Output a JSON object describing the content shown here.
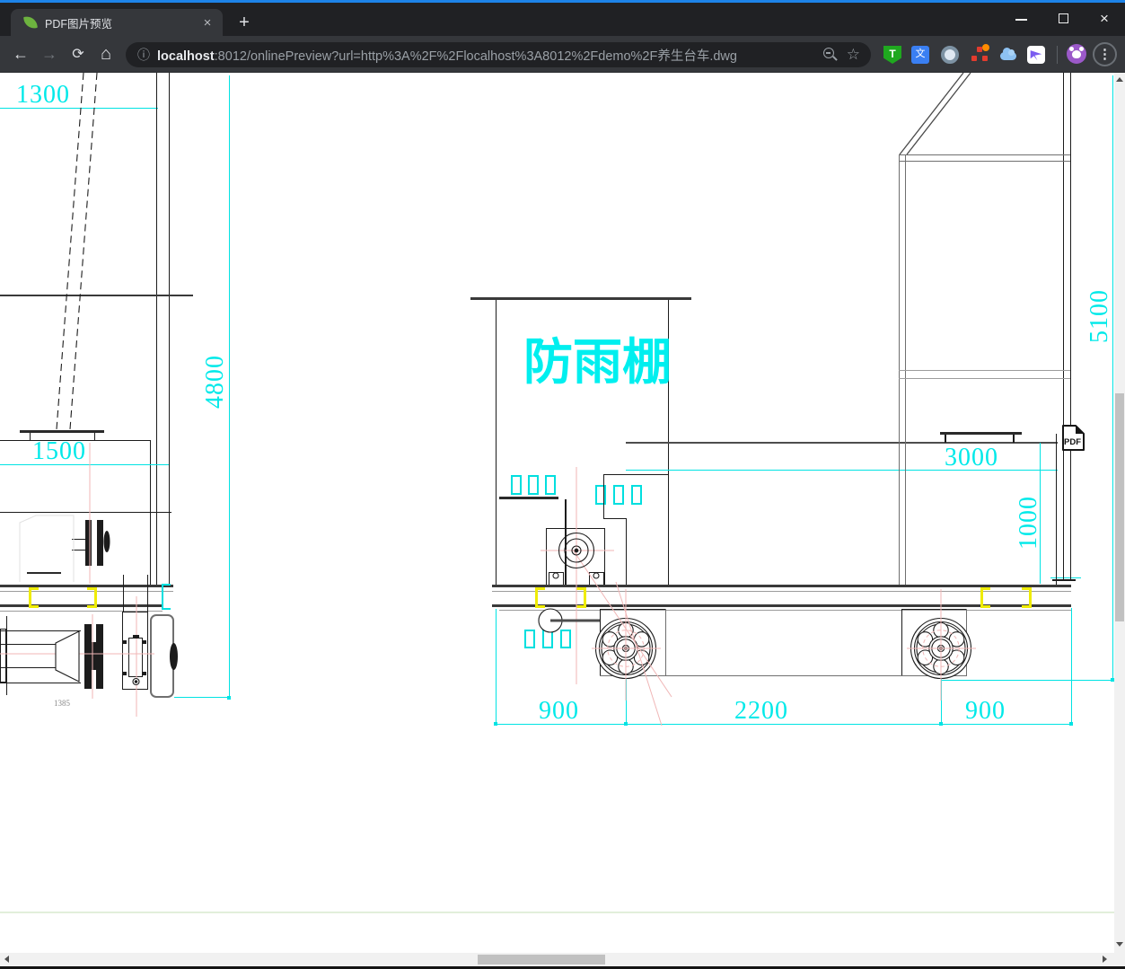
{
  "window": {
    "accent_color": "#1d83e8",
    "controls": {
      "close_glyph": "×"
    }
  },
  "browser": {
    "tab": {
      "title": "PDF图片预览",
      "close_glyph": "×"
    },
    "new_tab_glyph": "+",
    "nav": {
      "back_glyph": "←",
      "forward_glyph": "→",
      "reload_glyph": "⟳",
      "home_glyph": "⌂"
    },
    "omnibox": {
      "info_glyph": "ⓘ",
      "url_host": "localhost",
      "url_rest": ":8012/onlinePreview?url=http%3A%2F%2Flocalhost%3A8012%2Fdemo%2F养生台车.dwg",
      "bookmark_glyph": "☆"
    },
    "extensions": [
      {
        "name": "tampermonkey-icon",
        "letter": "T"
      },
      {
        "name": "translate-icon",
        "letter": "文"
      },
      {
        "name": "ring-icon"
      },
      {
        "name": "network-icon"
      },
      {
        "name": "cloud-icon"
      },
      {
        "name": "bird-icon"
      }
    ],
    "menu_glyph": "⋮"
  },
  "drawing": {
    "labels": {
      "canopy": "防雨棚",
      "pdf_badge": "PDF"
    },
    "dims": {
      "left_top_width": "1300",
      "left_total_height": "4800",
      "left_body_width": "1500",
      "left_axle_detail": "1385",
      "canopy_width": "3000",
      "deck_height": "1000",
      "overall_height": "5100",
      "front_overhang": "900",
      "wheelbase": "2200",
      "rear_overhang": "900"
    },
    "colors": {
      "dimension": "#00e3e3",
      "clamp": "#efec06",
      "centerline": "#f0b6b6"
    }
  }
}
